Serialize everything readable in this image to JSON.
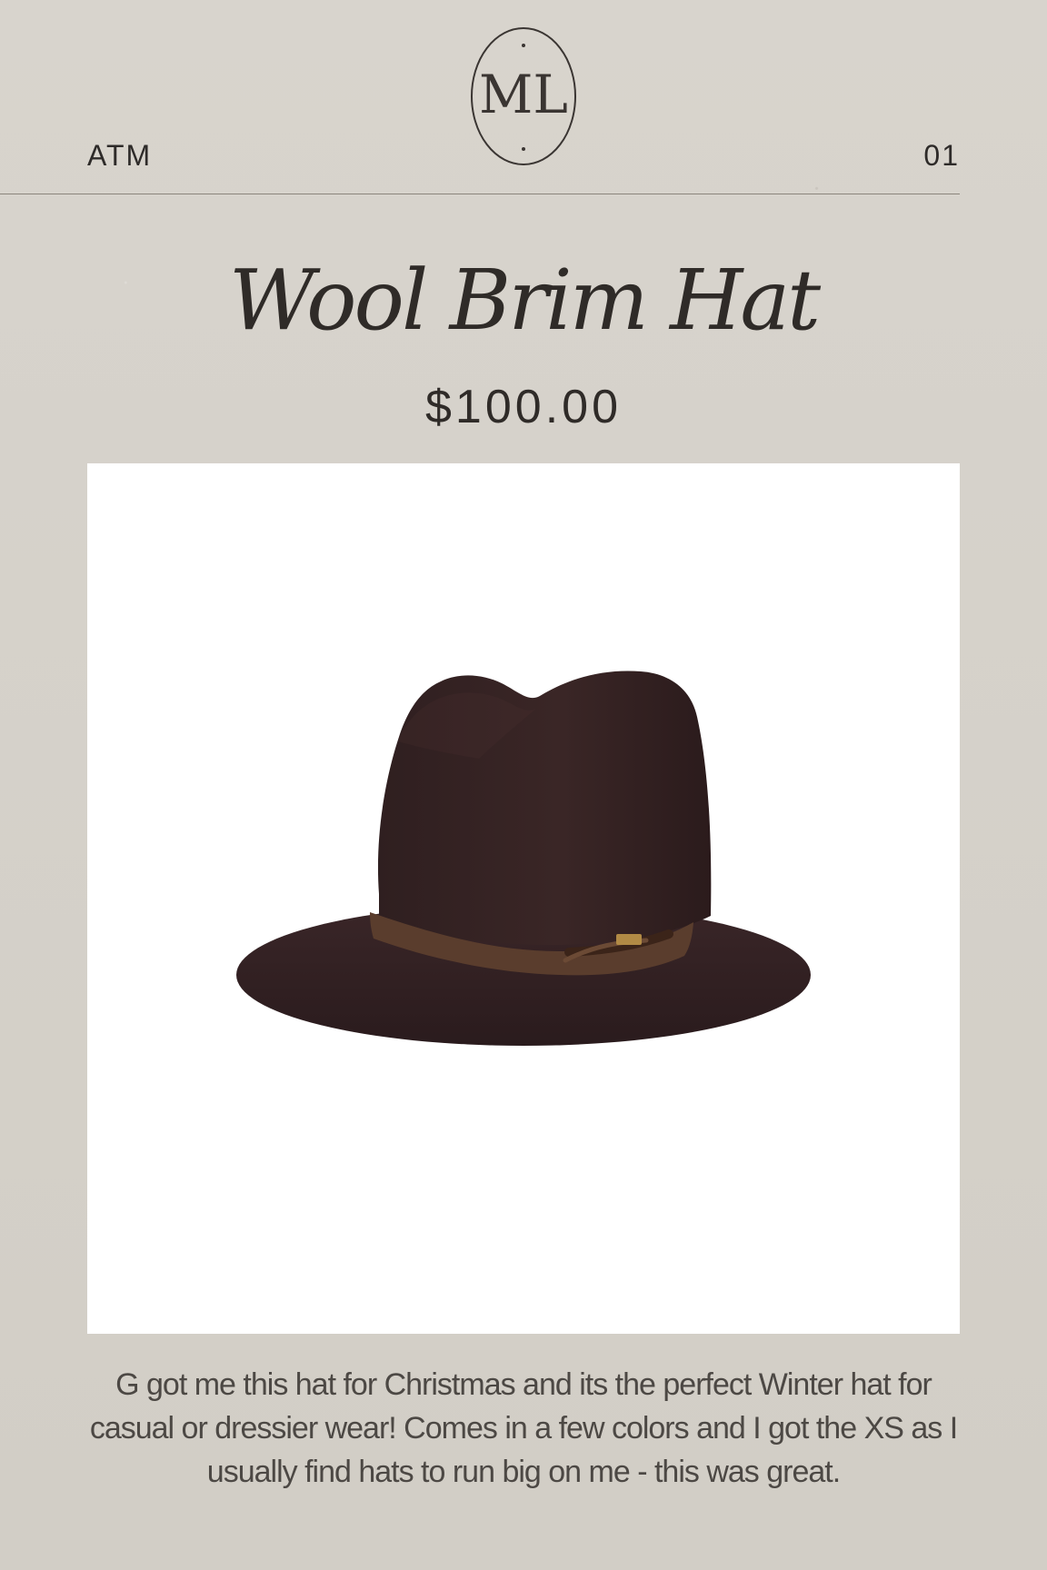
{
  "header": {
    "left_label": "ATM",
    "right_label": "01",
    "logo_text": "ML"
  },
  "product": {
    "title": "Wool Brim Hat",
    "price": "$100.00",
    "description": "G got me this hat for Christmas and its the perfect Winter hat for casual or dressier wear!  Comes in a few colors and I got the XS as I usually find hats to run big on me - this was great."
  },
  "image": {
    "icon": "brown-wool-brim-hat-icon"
  },
  "colors": {
    "background": "#d7d3cc",
    "text": "#2f2b28",
    "hat": "#3a2626",
    "band": "#5a3d2d"
  }
}
